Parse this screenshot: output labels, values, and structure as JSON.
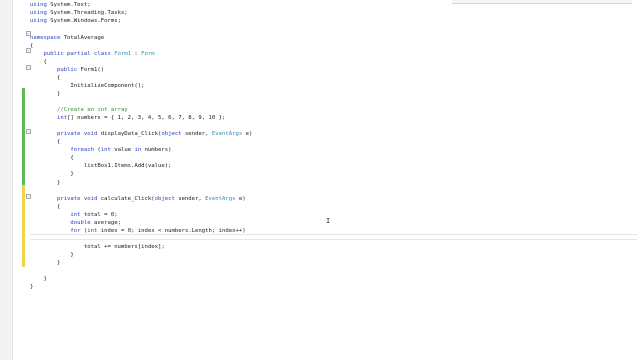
{
  "editor": {
    "lines": [
      [
        {
          "k": "kw",
          "t": "using "
        },
        {
          "k": "tx",
          "t": "System.Text;"
        }
      ],
      [
        {
          "k": "kw",
          "t": "using "
        },
        {
          "k": "tx",
          "t": "System.Threading.Tasks;"
        }
      ],
      [
        {
          "k": "kw",
          "t": "using "
        },
        {
          "k": "tx",
          "t": "System.Windows.Forms;"
        }
      ],
      [],
      [
        {
          "k": "kw",
          "t": "namespace "
        },
        {
          "k": "tx",
          "t": "TotalAverage"
        }
      ],
      [
        {
          "k": "tx",
          "t": "{"
        }
      ],
      [
        {
          "k": "tx",
          "t": "    "
        },
        {
          "k": "kw",
          "t": "public partial class "
        },
        {
          "k": "ty",
          "t": "Form1"
        },
        {
          "k": "tx",
          "t": " : "
        },
        {
          "k": "ty",
          "t": "Form"
        }
      ],
      [
        {
          "k": "tx",
          "t": "    {"
        }
      ],
      [
        {
          "k": "tx",
          "t": "        "
        },
        {
          "k": "kw",
          "t": "public "
        },
        {
          "k": "tx",
          "t": "Form1()"
        }
      ],
      [
        {
          "k": "tx",
          "t": "        {"
        }
      ],
      [
        {
          "k": "tx",
          "t": "            InitializeComponent();"
        }
      ],
      [
        {
          "k": "tx",
          "t": "        }"
        }
      ],
      [],
      [
        {
          "k": "tx",
          "t": "        "
        },
        {
          "k": "cm",
          "t": "//Create an int array"
        }
      ],
      [
        {
          "k": "tx",
          "t": "        "
        },
        {
          "k": "kw",
          "t": "int"
        },
        {
          "k": "tx",
          "t": "[] numbers = { 1, 2, 3, 4, 5, 6, 7, 8, 9, 10 };"
        }
      ],
      [],
      [
        {
          "k": "tx",
          "t": "        "
        },
        {
          "k": "kw",
          "t": "private void "
        },
        {
          "k": "tx",
          "t": "displayData_Click("
        },
        {
          "k": "kw",
          "t": "object "
        },
        {
          "k": "tx",
          "t": "sender, "
        },
        {
          "k": "ty",
          "t": "EventArgs"
        },
        {
          "k": "tx",
          "t": " e)"
        }
      ],
      [
        {
          "k": "tx",
          "t": "        {"
        }
      ],
      [
        {
          "k": "tx",
          "t": "            "
        },
        {
          "k": "kw",
          "t": "foreach "
        },
        {
          "k": "tx",
          "t": "("
        },
        {
          "k": "kw",
          "t": "int "
        },
        {
          "k": "tx",
          "t": "value "
        },
        {
          "k": "kw",
          "t": "in "
        },
        {
          "k": "tx",
          "t": "numbers)"
        }
      ],
      [
        {
          "k": "tx",
          "t": "            {"
        }
      ],
      [
        {
          "k": "tx",
          "t": "                listBox1.Items.Add(value);"
        }
      ],
      [
        {
          "k": "tx",
          "t": "            }"
        }
      ],
      [
        {
          "k": "tx",
          "t": "        }"
        }
      ],
      [],
      [
        {
          "k": "tx",
          "t": "        "
        },
        {
          "k": "kw",
          "t": "private void "
        },
        {
          "k": "tx",
          "t": "calculate_Click("
        },
        {
          "k": "kw",
          "t": "object "
        },
        {
          "k": "tx",
          "t": "sender, "
        },
        {
          "k": "ty",
          "t": "EventArgs"
        },
        {
          "k": "tx",
          "t": " e)"
        }
      ],
      [
        {
          "k": "tx",
          "t": "        {"
        }
      ],
      [
        {
          "k": "tx",
          "t": "            "
        },
        {
          "k": "kw",
          "t": "int "
        },
        {
          "k": "tx",
          "t": "total = 0;"
        }
      ],
      [
        {
          "k": "tx",
          "t": "            "
        },
        {
          "k": "kw",
          "t": "double "
        },
        {
          "k": "tx",
          "t": "average;"
        }
      ],
      [
        {
          "k": "tx",
          "t": "            "
        },
        {
          "k": "kw",
          "t": "for "
        },
        {
          "k": "tx",
          "t": "("
        },
        {
          "k": "kw",
          "t": "int "
        },
        {
          "k": "tx",
          "t": "index = 0; index < numbers.Length; index++)"
        }
      ],
      [],
      [
        {
          "k": "tx",
          "t": "                total += numbers[index];"
        }
      ],
      [
        {
          "k": "tx",
          "t": "            }"
        }
      ],
      [
        {
          "k": "tx",
          "t": "        }"
        }
      ],
      [],
      [
        {
          "k": "tx",
          "t": "    }"
        }
      ],
      [
        {
          "k": "tx",
          "t": "}"
        }
      ]
    ],
    "change_bars": [
      {
        "status": "saved"
      },
      {
        "status": "unsaved"
      }
    ],
    "caret_glyph": "I"
  }
}
